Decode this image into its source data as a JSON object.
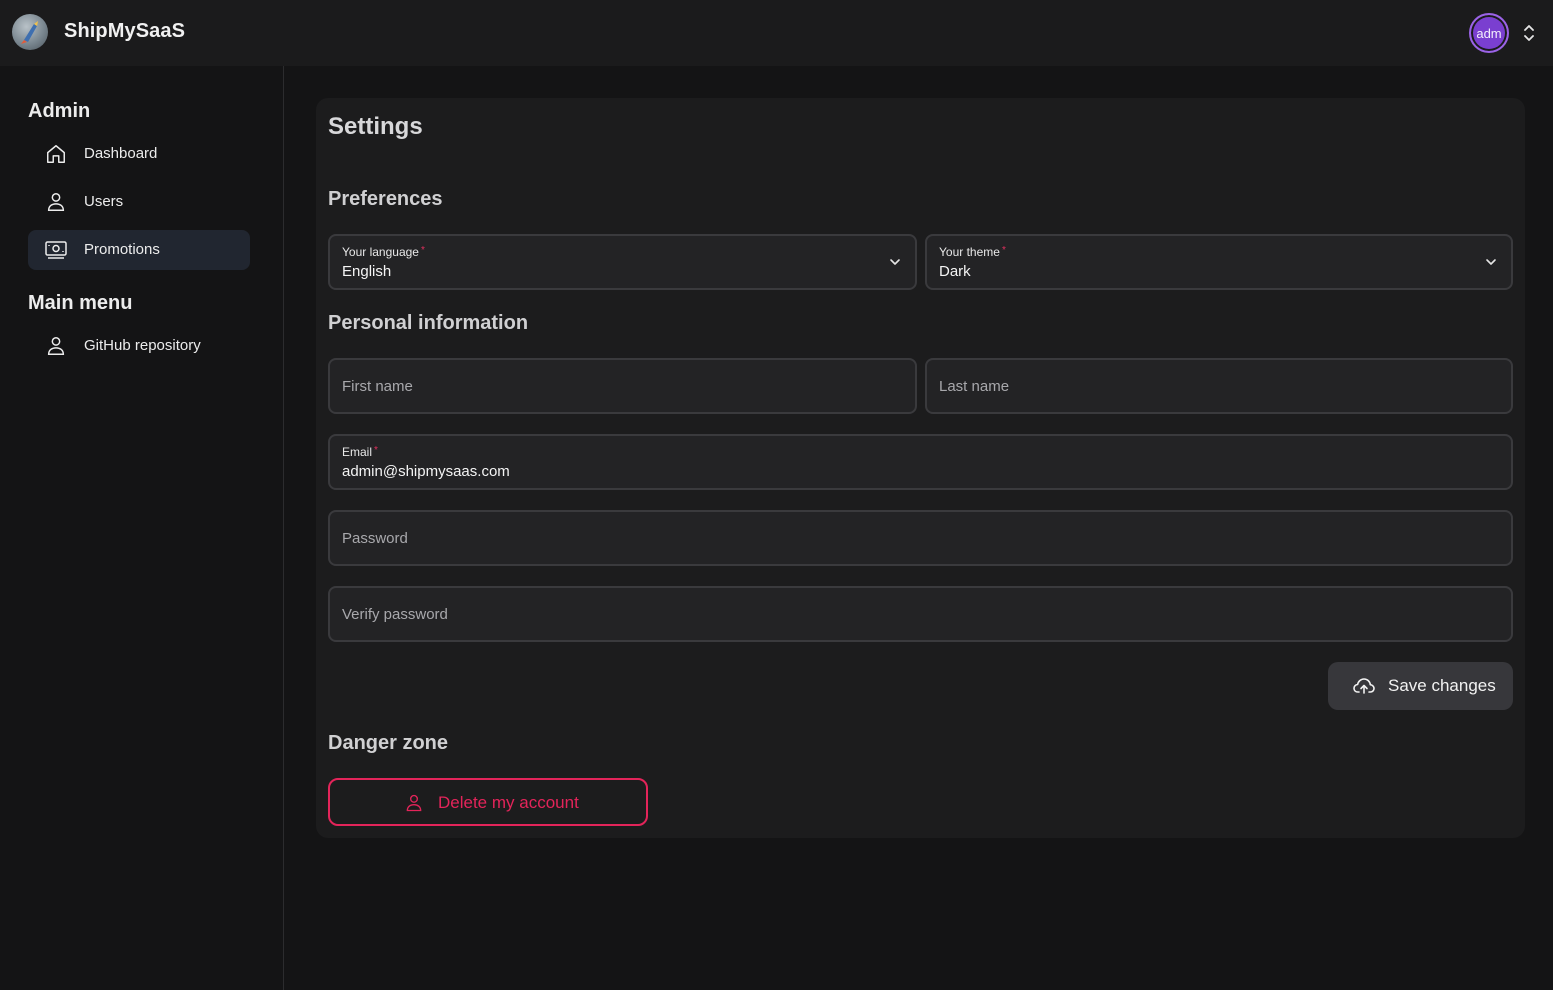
{
  "app": {
    "title": "ShipMySaaS"
  },
  "user": {
    "avatar_initials": "adm"
  },
  "sidebar": {
    "sections": [
      {
        "title": "Admin",
        "items": [
          {
            "label": "Dashboard",
            "icon": "home-icon",
            "active": false
          },
          {
            "label": "Users",
            "icon": "user-icon",
            "active": false
          },
          {
            "label": "Promotions",
            "icon": "money-icon",
            "active": true
          }
        ]
      },
      {
        "title": "Main menu",
        "items": [
          {
            "label": "GitHub repository",
            "icon": "user-icon",
            "active": false
          }
        ]
      }
    ]
  },
  "settings": {
    "title": "Settings",
    "preferences": {
      "heading": "Preferences",
      "language": {
        "label": "Your language",
        "required": "*",
        "value": "English"
      },
      "theme": {
        "label": "Your theme",
        "required": "*",
        "value": "Dark"
      }
    },
    "personal": {
      "heading": "Personal information",
      "first_name": {
        "placeholder": "First name"
      },
      "last_name": {
        "placeholder": "Last name"
      },
      "email": {
        "label": "Email",
        "required": "*",
        "value": "admin@shipmysaas.com"
      },
      "password": {
        "placeholder": "Password"
      },
      "verify_password": {
        "placeholder": "Verify password"
      }
    },
    "save_label": "Save changes",
    "danger": {
      "heading": "Danger zone",
      "delete_label": "Delete my account"
    }
  },
  "colors": {
    "accent_danger": "#e3245a",
    "avatar": "#7a3fd0",
    "active_nav": "#212630"
  }
}
